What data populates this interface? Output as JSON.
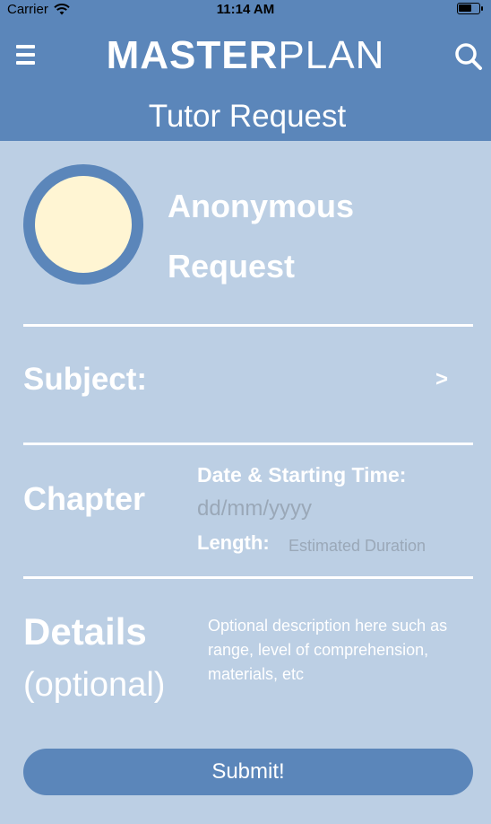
{
  "status_bar": {
    "carrier": "Carrier",
    "time": "11:14 AM"
  },
  "header": {
    "brand_bold": "MASTER",
    "brand_light": "PLAN",
    "menu_icon": "hamburger-menu-icon",
    "search_icon": "search-icon"
  },
  "page": {
    "title": "Tutor Request"
  },
  "profile": {
    "name_line1": "Anonymous",
    "name_line2": "Request"
  },
  "subject": {
    "label": "Subject:",
    "chevron": ">"
  },
  "chapter": {
    "label": "Chapter"
  },
  "schedule": {
    "datetime_label": "Date & Starting Time:",
    "date_placeholder": "dd/mm/yyyy",
    "length_label": "Length:",
    "length_placeholder": "Estimated Duration"
  },
  "details": {
    "label": "Details",
    "optional": "(optional)",
    "placeholder": "Optional description here such as range, level of comprehension, materials, etc"
  },
  "submit": {
    "label": "Submit!"
  },
  "colors": {
    "background": "#bccfe4",
    "primary": "#5b86ba",
    "avatar_fill": "#fff5d3",
    "placeholder_text": "#9aa8b8"
  }
}
